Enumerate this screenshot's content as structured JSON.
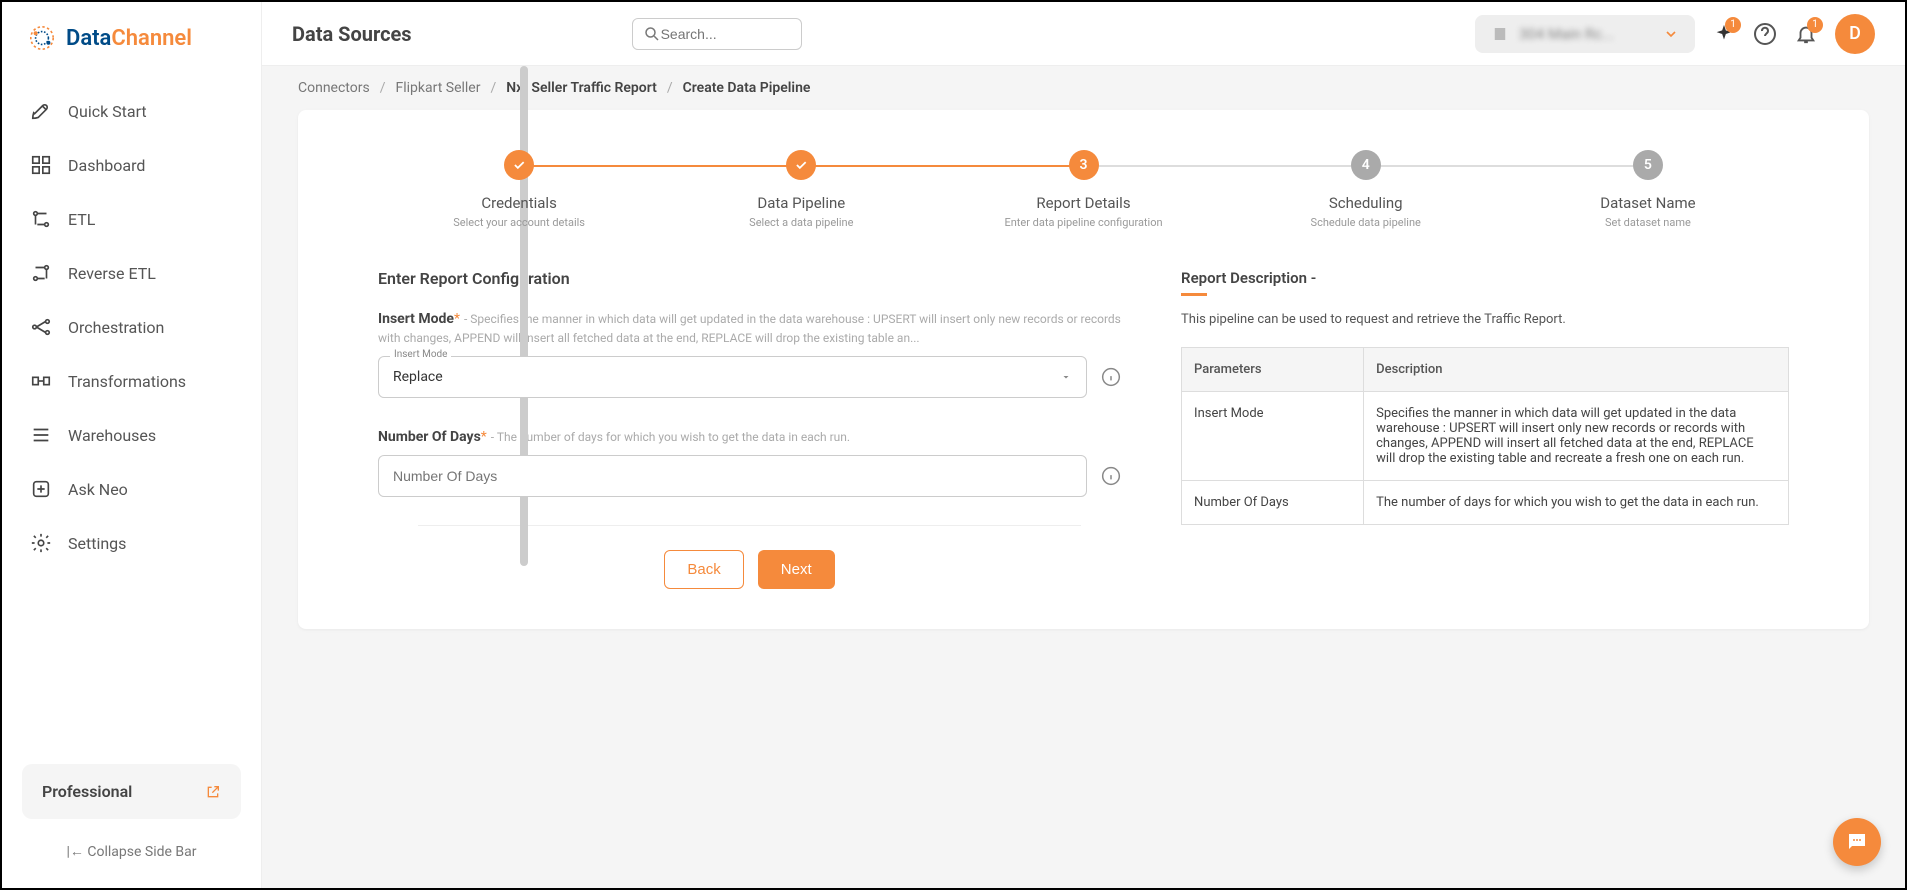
{
  "brand": {
    "name1": "Data",
    "name2": "Channel"
  },
  "sidebar": {
    "items": [
      {
        "label": "Quick Start"
      },
      {
        "label": "Dashboard"
      },
      {
        "label": "ETL"
      },
      {
        "label": "Reverse ETL"
      },
      {
        "label": "Orchestration"
      },
      {
        "label": "Transformations"
      },
      {
        "label": "Warehouses"
      },
      {
        "label": "Ask Neo"
      },
      {
        "label": "Settings"
      }
    ],
    "plan": "Professional",
    "collapse": "Collapse Side Bar"
  },
  "header": {
    "title": "Data Sources",
    "search_placeholder": "Search...",
    "org_blur": "304 Main Rc...",
    "badge1": "1",
    "badge2": "1",
    "avatar": "D"
  },
  "breadcrumb": {
    "items": [
      "Connectors",
      "Flipkart Seller",
      "Nxt Seller Traffic Report",
      "Create Data Pipeline"
    ]
  },
  "stepper": [
    {
      "title": "Credentials",
      "sub": "Select your account details",
      "state": "done"
    },
    {
      "title": "Data Pipeline",
      "sub": "Select a data pipeline",
      "state": "done"
    },
    {
      "title": "Report Details",
      "sub": "Enter data pipeline configuration",
      "state": "active",
      "num": "3"
    },
    {
      "title": "Scheduling",
      "sub": "Schedule data pipeline",
      "state": "pending",
      "num": "4"
    },
    {
      "title": "Dataset Name",
      "sub": "Set dataset name",
      "state": "pending",
      "num": "5"
    }
  ],
  "form": {
    "heading": "Enter Report Configuration",
    "insert_mode": {
      "label": "Insert Mode",
      "help": "- Specifies the manner in which data will get updated in the data warehouse : UPSERT will insert only new records or records with changes, APPEND will insert all fetched data at the end, REPLACE will drop the existing table an...",
      "floating": "Insert Mode",
      "value": "Replace"
    },
    "num_days": {
      "label": "Number Of Days",
      "help": "- The number of days for which you wish to get the data in each run.",
      "placeholder": "Number Of Days"
    },
    "back": "Back",
    "next": "Next"
  },
  "description": {
    "heading": "Report Description -",
    "text": "This pipeline can be used to request and retrieve the Traffic Report.",
    "col1": "Parameters",
    "col2": "Description",
    "rows": [
      {
        "p": "Insert Mode",
        "d": "Specifies the manner in which data will get updated in the data warehouse : UPSERT will insert only new records or records with changes, APPEND will insert all fetched data at the end, REPLACE will drop the existing table and recreate a fresh one on each run."
      },
      {
        "p": "Number Of Days",
        "d": "The number of days for which you wish to get the data in each run."
      }
    ]
  }
}
